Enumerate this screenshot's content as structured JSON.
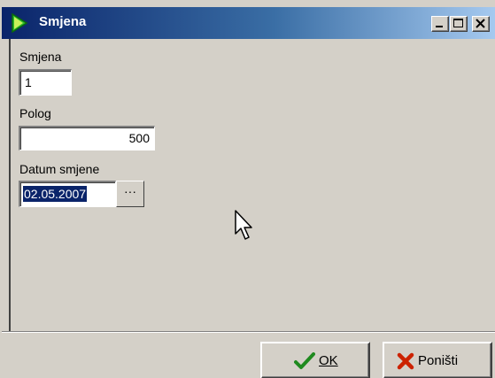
{
  "window": {
    "title": "Smjena",
    "colors": {
      "title_gradient_start": "#0a246a",
      "title_gradient_end": "#a6caf0",
      "face": "#d4d0c8",
      "selection": "#0a246a"
    },
    "icon": "app-play-icon"
  },
  "form": {
    "smjena": {
      "label": "Smjena",
      "value": "1"
    },
    "polog": {
      "label": "Polog",
      "value": "500"
    },
    "datum": {
      "label": "Datum smjene",
      "value": "02.05.2007",
      "picker_label": "···"
    }
  },
  "buttons": {
    "ok": {
      "label": "OK",
      "icon": "check-icon",
      "icon_color": "#1f8a1f"
    },
    "cancel": {
      "label": "Poništi",
      "icon": "x-icon",
      "icon_color": "#cc2200"
    }
  }
}
